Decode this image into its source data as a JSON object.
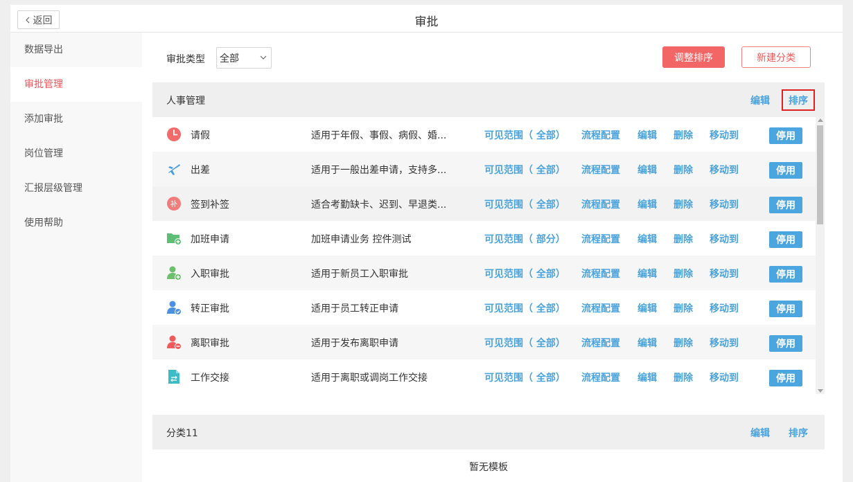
{
  "header": {
    "back_label": "返回",
    "title": "审批"
  },
  "sidebar": {
    "items": [
      {
        "label": "数据导出",
        "active": false
      },
      {
        "label": "审批管理",
        "active": true
      },
      {
        "label": "添加审批",
        "active": false
      },
      {
        "label": "岗位管理",
        "active": false
      },
      {
        "label": "汇报层级管理",
        "active": false
      },
      {
        "label": "使用帮助",
        "active": false
      }
    ]
  },
  "toolbar": {
    "filter_label": "审批类型",
    "filter_value": "全部",
    "sort_button": "调整排序",
    "new_category_button": "新建分类"
  },
  "categories": [
    {
      "name": "人事管理",
      "edit_label": "编辑",
      "sort_label": "排序",
      "templates": [
        {
          "icon": "clock-icon",
          "icon_color": "#f26b6b",
          "title": "请假",
          "desc": "适用于年假、事假、病假、婚...",
          "scope": "可见范围（ 全部）",
          "flow": "流程配置",
          "edit": "编辑",
          "delete": "删除",
          "move": "移动到",
          "disable": "停用"
        },
        {
          "icon": "airplane-icon",
          "icon_color": "#4a9de0",
          "title": "出差",
          "desc": "适用于一般出差申请，支持多...",
          "scope": "可见范围（ 全部）",
          "flow": "流程配置",
          "edit": "编辑",
          "delete": "删除",
          "move": "移动到",
          "disable": "停用"
        },
        {
          "icon": "supplement-icon",
          "icon_color": "#f07c7c",
          "title": "签到补签",
          "desc": "适合考勤缺卡、迟到、早退类...",
          "scope": "可见范围（ 全部）",
          "flow": "流程配置",
          "edit": "编辑",
          "delete": "删除",
          "move": "移动到",
          "disable": "停用"
        },
        {
          "icon": "folder-add-icon",
          "icon_color": "#5cbf75",
          "title": "加班申请",
          "desc": "加班申请业务 控件测试",
          "scope": "可见范围（ 部分）",
          "flow": "流程配置",
          "edit": "编辑",
          "delete": "删除",
          "move": "移动到",
          "disable": "停用"
        },
        {
          "icon": "user-add-icon",
          "icon_color": "#6cbf6c",
          "title": "入职审批",
          "desc": "适用于新员工入职审批",
          "scope": "可见范围（ 全部）",
          "flow": "流程配置",
          "edit": "编辑",
          "delete": "删除",
          "move": "移动到",
          "disable": "停用"
        },
        {
          "icon": "user-check-icon",
          "icon_color": "#4a8fe0",
          "title": "转正审批",
          "desc": "适用于员工转正申请",
          "scope": "可见范围（ 全部）",
          "flow": "流程配置",
          "edit": "编辑",
          "delete": "删除",
          "move": "移动到",
          "disable": "停用"
        },
        {
          "icon": "user-remove-icon",
          "icon_color": "#f05a5a",
          "title": "离职审批",
          "desc": "适用于发布离职申请",
          "scope": "可见范围（ 全部）",
          "flow": "流程配置",
          "edit": "编辑",
          "delete": "删除",
          "move": "移动到",
          "disable": "停用"
        },
        {
          "icon": "document-transfer-icon",
          "icon_color": "#3cbcc6",
          "title": "工作交接",
          "desc": "适用于离职或调岗工作交接",
          "scope": "可见范围（ 全部）",
          "flow": "流程配置",
          "edit": "编辑",
          "delete": "删除",
          "move": "移动到",
          "disable": "停用"
        }
      ]
    },
    {
      "name": "分类11",
      "edit_label": "编辑",
      "sort_label": "排序",
      "empty_text": "暂无模板"
    }
  ],
  "colors": {
    "accent_red": "#f26666",
    "link_blue": "#4ba3dc",
    "button_blue": "#4ba6df"
  }
}
